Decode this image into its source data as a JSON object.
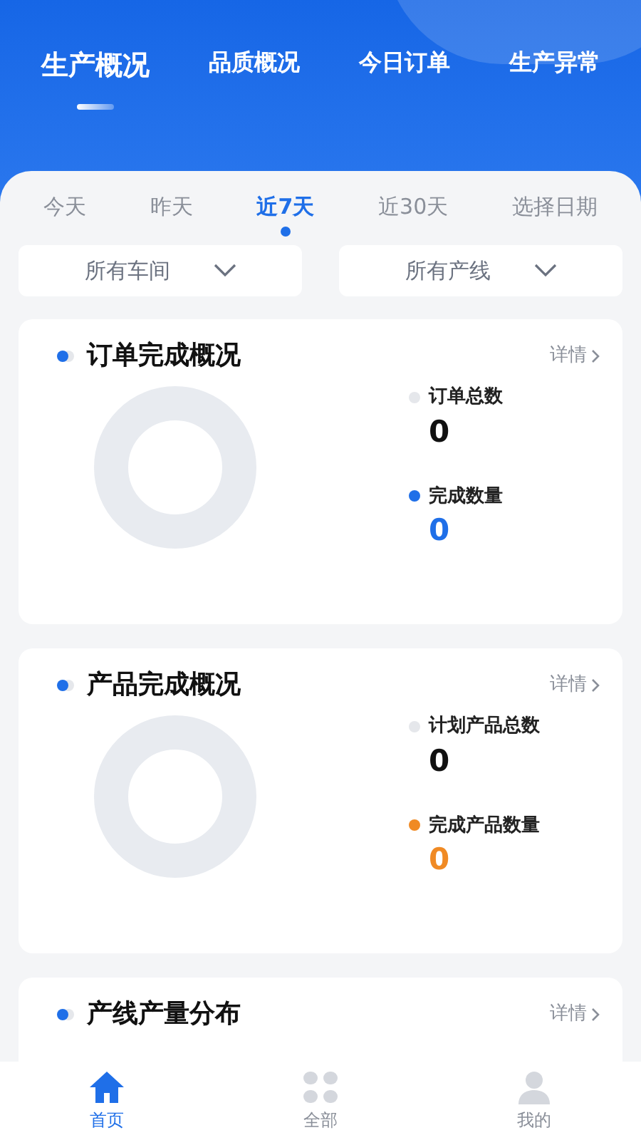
{
  "top_tabs": [
    {
      "label": "生产概况",
      "selected": true
    },
    {
      "label": "品质概况",
      "selected": false
    },
    {
      "label": "今日订单",
      "selected": false
    },
    {
      "label": "生产异常",
      "selected": false
    }
  ],
  "date_tabs": [
    {
      "label": "今天",
      "selected": false
    },
    {
      "label": "昨天",
      "selected": false
    },
    {
      "label": "近7天",
      "selected": true
    },
    {
      "label": "近30天",
      "selected": false
    },
    {
      "label": "选择日期",
      "selected": false
    }
  ],
  "filters": [
    {
      "value": "所有车间"
    },
    {
      "value": "所有产线"
    }
  ],
  "cards": [
    {
      "title": "订单完成概况",
      "link": "详情",
      "legend": [
        {
          "label": "订单总数",
          "value": "0",
          "color": "#e5e7eb",
          "highlight": false
        },
        {
          "label": "完成数量",
          "value": "0",
          "color": "#1f6fe8",
          "highlight": true
        }
      ]
    },
    {
      "title": "产品完成概况",
      "link": "详情",
      "legend": [
        {
          "label": "计划产品总数",
          "value": "0",
          "color": "#e5e7eb",
          "highlight": false
        },
        {
          "label": "完成产品数量",
          "value": "0",
          "color": "#f08a24",
          "highlight": true
        }
      ]
    },
    {
      "title": "产线产量分布",
      "link": "详情"
    }
  ],
  "bottom_nav": [
    {
      "label": "首页",
      "kind": "home",
      "selected": true
    },
    {
      "label": "全部",
      "kind": "grid",
      "selected": false
    },
    {
      "label": "我的",
      "kind": "person",
      "selected": false
    }
  ]
}
